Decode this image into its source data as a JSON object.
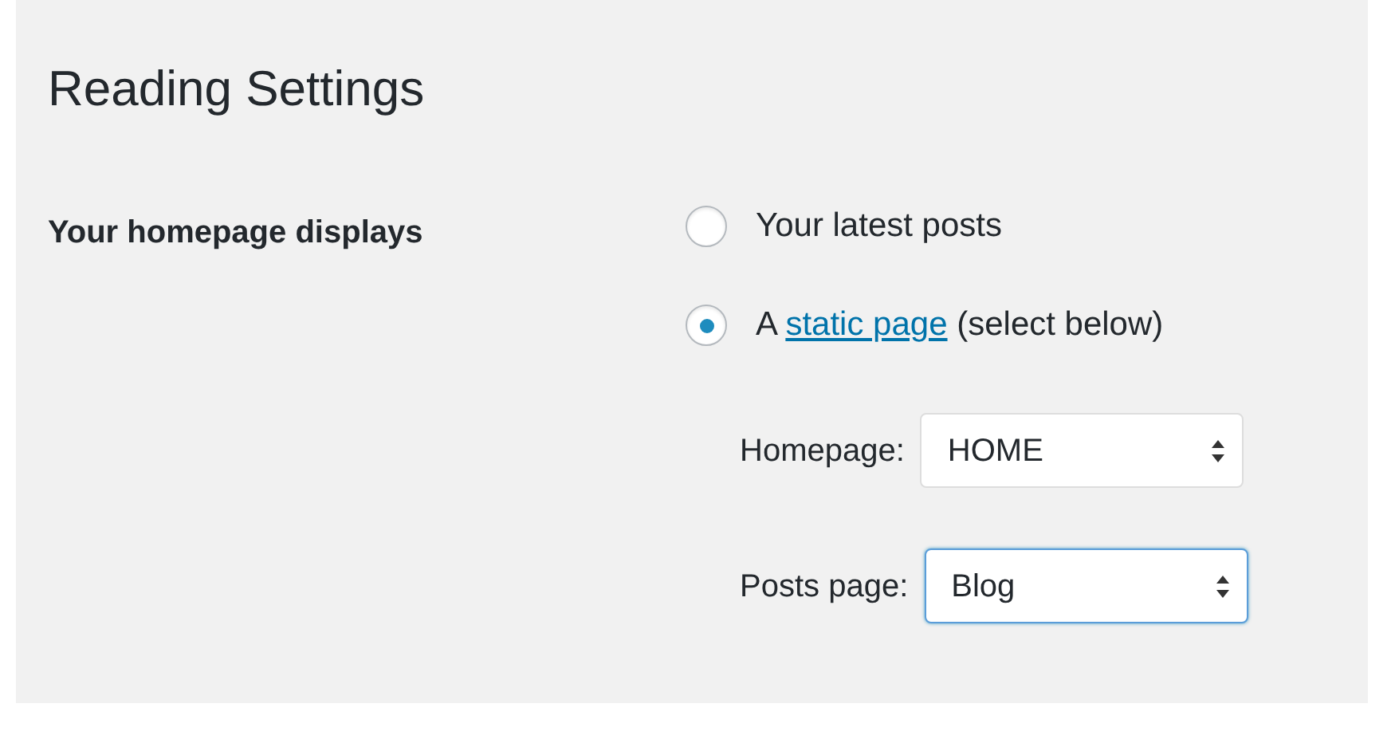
{
  "title": "Reading Settings",
  "field_label": "Your homepage displays",
  "options": [
    {
      "parts": [
        {
          "kind": "text",
          "text": "Your latest posts"
        }
      ],
      "selected": false
    },
    {
      "parts": [
        {
          "kind": "text",
          "text": "A "
        },
        {
          "kind": "link",
          "text": "static page"
        },
        {
          "kind": "text",
          "text": " (select below)"
        }
      ],
      "selected": true
    }
  ],
  "selects": [
    {
      "label": "Homepage:",
      "value": "HOME",
      "focused": false
    },
    {
      "label": "Posts page:",
      "value": "Blog",
      "focused": true
    }
  ]
}
